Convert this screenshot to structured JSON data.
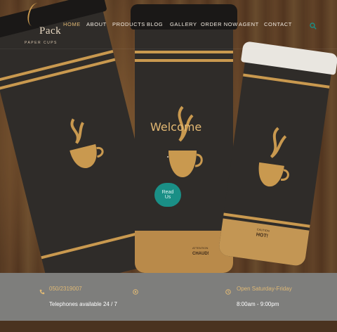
{
  "brand": {
    "name": "Pack",
    "tagline": "PAPER CUPS"
  },
  "nav": {
    "items": [
      {
        "label": "HOME",
        "active": true
      },
      {
        "label": "ABOUT",
        "active": false
      },
      {
        "label": "PRODUCTS",
        "active": false
      },
      {
        "label": "BLOG",
        "active": false
      },
      {
        "label": "GALLERY",
        "active": false
      },
      {
        "label": "ORDER NOW",
        "active": false
      },
      {
        "label": "AGENT",
        "active": false
      },
      {
        "label": "CONTACT",
        "active": false
      }
    ],
    "search_icon": "search-icon"
  },
  "hero": {
    "heading": "Welcome",
    "button_label": "Read Us"
  },
  "cups": {
    "cup2_print_top": "ATTENTION",
    "cup2_print_bottom": "CHAUD!",
    "cup3_print_top": "CAUTION",
    "cup3_print_bottom": "HOT!"
  },
  "info": {
    "phone": "050/2319007",
    "phone_note": "Telephones available 24 / 7",
    "hours_title": "Open Saturday-Friday",
    "hours": "8:00am - 9:00pm",
    "icons": [
      "phone-icon",
      "location-icon",
      "clock-icon"
    ]
  },
  "colors": {
    "accent": "#e0b974",
    "button": "#1a8f86",
    "info_bar": "#7e7e7c"
  }
}
